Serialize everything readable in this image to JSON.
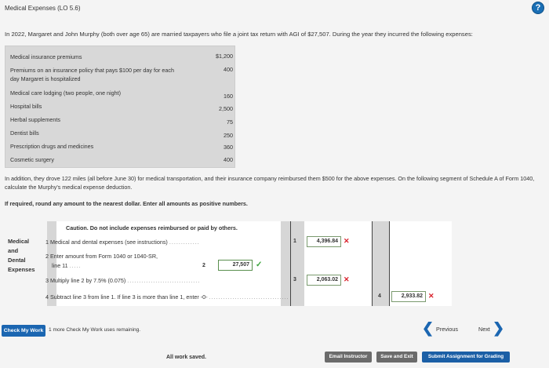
{
  "header": {
    "title": "Medical Expenses (LO 5.6)",
    "help_icon": "question-icon"
  },
  "intro": "In 2022, Margaret and John Murphy (both over age 65) are married taxpayers who file a joint tax return with AGI of $27,507. During the year they incurred the following expenses:",
  "expenses": [
    {
      "label": "Medical insurance premiums",
      "value": "$1,200"
    },
    {
      "label": "Premiums on an insurance policy that pays $100 per day for each day Margaret is hospitalized",
      "value": "400"
    },
    {
      "label": "Medical care lodging (two people, one night)",
      "value": "160"
    },
    {
      "label": "Hospital bills",
      "value": "2,500"
    },
    {
      "label": "Herbal supplements",
      "value": "75"
    },
    {
      "label": "Dentist bills",
      "value": "250"
    },
    {
      "label": "Prescription drugs and medicines",
      "value": "360"
    },
    {
      "label": "Cosmetic surgery",
      "value": "400"
    }
  ],
  "paragraph": "In addition, they drove 122 miles (all before June 30) for medical transportation, and their insurance company reimbursed them $500 for the above expenses. On the following segment of Schedule A of Form 1040, calculate the Murphy's medical expense deduction.",
  "instruction": "If required, round any amount to the nearest dollar. Enter all amounts as positive numbers.",
  "worksheet": {
    "caution": "Caution. Do not include expenses reimbursed or paid by others.",
    "side_label": [
      "Medical",
      "and",
      "Dental",
      "Expenses"
    ],
    "line1": {
      "num": "1",
      "text": "Medical and dental expenses (see instructions)",
      "dots": ".............",
      "box_num": "1",
      "value": "4,396.84",
      "status": "✕"
    },
    "line2": {
      "num": "2",
      "text_a": "Enter amount from Form 1040 or 1040-SR,",
      "text_b": "line 11",
      "dots": ".....",
      "box_num": "2",
      "value": "27,507",
      "status": "✓"
    },
    "line3": {
      "num": "3",
      "text": "Multiply line 2 by 7.5% (0.075)",
      "dots": "...............................",
      "box_num": "3",
      "value": "2,063.02",
      "status": "✕"
    },
    "line4": {
      "num": "4",
      "text": "Subtract line 3 from line 1. If line 3 is more than line 1, enter -0-",
      "dots": "..................................",
      "box_num": "4",
      "value": "2,933.82",
      "status": "✕"
    }
  },
  "footer": {
    "check_button": "Check My Work",
    "remaining": "1 more Check My Work uses remaining.",
    "previous": "Previous",
    "next": "Next",
    "saved": "All work saved.",
    "email": "Email Instructor",
    "save_exit": "Save and Exit",
    "submit": "Submit Assignment for Grading"
  }
}
